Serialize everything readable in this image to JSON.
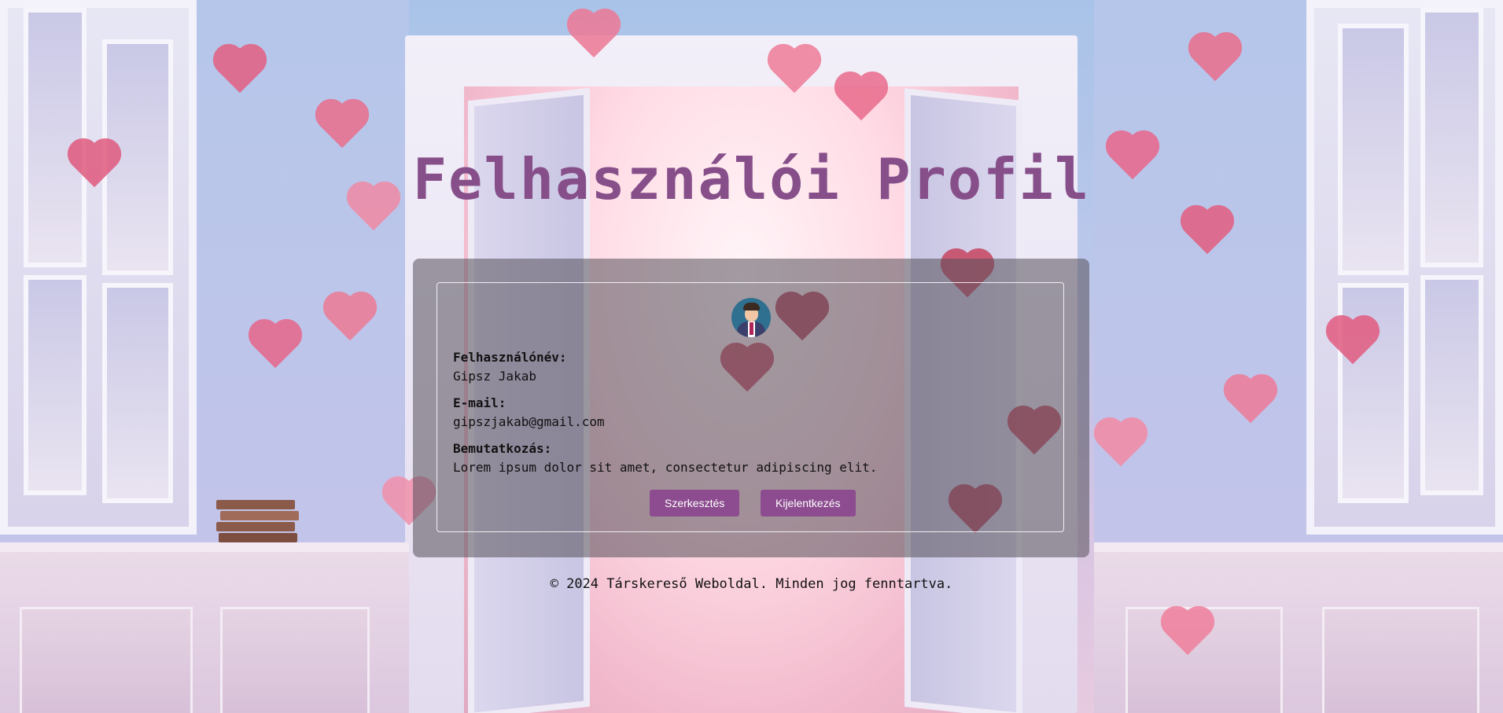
{
  "page": {
    "title": "Felhasználói Profil"
  },
  "profile": {
    "username_label": "Felhasználónév:",
    "username_value": "Gipsz Jakab",
    "email_label": "E-mail:",
    "email_value": "gipszjakab@gmail.com",
    "bio_label": "Bemutatkozás:",
    "bio_value": "Lorem ipsum dolor sit amet, consectetur adipiscing elit.",
    "avatar_icon": "user-avatar-icon"
  },
  "actions": {
    "edit_label": "Szerkesztés",
    "logout_label": "Kijelentkezés"
  },
  "footer": {
    "text": "© 2024 Társkereső Weboldal. Minden jog fenntartva."
  },
  "colors": {
    "accent": "#8c4c8f",
    "title": "#874f8a",
    "heart": "#e2607f"
  }
}
